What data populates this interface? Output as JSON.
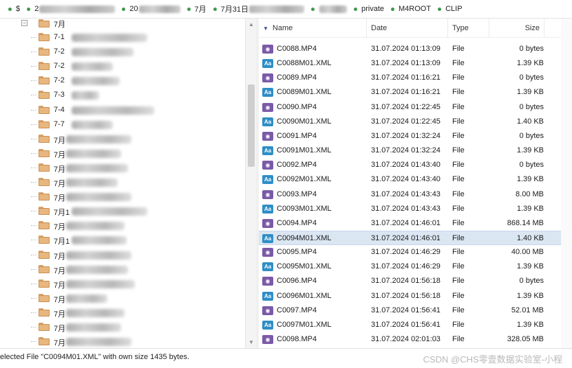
{
  "breadcrumb": {
    "items": [
      {
        "label": "$"
      },
      {
        "label": "2"
      },
      {
        "label": "20"
      },
      {
        "label": "7月"
      },
      {
        "label": "7月31日"
      },
      {
        "label": ""
      },
      {
        "label": "private"
      },
      {
        "label": "M4ROOT"
      },
      {
        "label": "CLIP"
      }
    ]
  },
  "tree": {
    "root_label": "7月",
    "root_toggle": "−",
    "folders": [
      {
        "label": "7-1"
      },
      {
        "label": "7-2"
      },
      {
        "label": "7-2"
      },
      {
        "label": "7-2"
      },
      {
        "label": "7-3"
      },
      {
        "label": "7-4"
      },
      {
        "label": "7-7"
      },
      {
        "label": "7月"
      },
      {
        "label": "7月"
      },
      {
        "label": "7月"
      },
      {
        "label": "7月"
      },
      {
        "label": "7月"
      },
      {
        "label": "7月1"
      },
      {
        "label": "7月"
      },
      {
        "label": "7月1"
      },
      {
        "label": "7月"
      },
      {
        "label": "7月"
      },
      {
        "label": "7月"
      },
      {
        "label": "7月"
      },
      {
        "label": "7月"
      },
      {
        "label": "7月"
      },
      {
        "label": "7月"
      },
      {
        "label": "7月"
      }
    ]
  },
  "files": {
    "columns": {
      "name": "Name",
      "date": "Date",
      "type": "Type",
      "size": "Size"
    },
    "rows": [
      {
        "name": "C0088.MP4",
        "date": "31.07.2024 01:13:09",
        "type": "File",
        "size": "0 bytes",
        "kind": "mp4"
      },
      {
        "name": "C0088M01.XML",
        "date": "31.07.2024 01:13:09",
        "type": "File",
        "size": "1.39 KB",
        "kind": "xml"
      },
      {
        "name": "C0089.MP4",
        "date": "31.07.2024 01:16:21",
        "type": "File",
        "size": "0 bytes",
        "kind": "mp4"
      },
      {
        "name": "C0089M01.XML",
        "date": "31.07.2024 01:16:21",
        "type": "File",
        "size": "1.39 KB",
        "kind": "xml"
      },
      {
        "name": "C0090.MP4",
        "date": "31.07.2024 01:22:45",
        "type": "File",
        "size": "0 bytes",
        "kind": "mp4"
      },
      {
        "name": "C0090M01.XML",
        "date": "31.07.2024 01:22:45",
        "type": "File",
        "size": "1.40 KB",
        "kind": "xml"
      },
      {
        "name": "C0091.MP4",
        "date": "31.07.2024 01:32:24",
        "type": "File",
        "size": "0 bytes",
        "kind": "mp4"
      },
      {
        "name": "C0091M01.XML",
        "date": "31.07.2024 01:32:24",
        "type": "File",
        "size": "1.39 KB",
        "kind": "xml"
      },
      {
        "name": "C0092.MP4",
        "date": "31.07.2024 01:43:40",
        "type": "File",
        "size": "0 bytes",
        "kind": "mp4"
      },
      {
        "name": "C0092M01.XML",
        "date": "31.07.2024 01:43:40",
        "type": "File",
        "size": "1.39 KB",
        "kind": "xml"
      },
      {
        "name": "C0093.MP4",
        "date": "31.07.2024 01:43:43",
        "type": "File",
        "size": "8.00 MB",
        "kind": "mp4"
      },
      {
        "name": "C0093M01.XML",
        "date": "31.07.2024 01:43:43",
        "type": "File",
        "size": "1.39 KB",
        "kind": "xml"
      },
      {
        "name": "C0094.MP4",
        "date": "31.07.2024 01:46:01",
        "type": "File",
        "size": "868.14 MB",
        "kind": "mp4"
      },
      {
        "name": "C0094M01.XML",
        "date": "31.07.2024 01:46:01",
        "type": "File",
        "size": "1.40 KB",
        "kind": "xml",
        "selected": true
      },
      {
        "name": "C0095.MP4",
        "date": "31.07.2024 01:46:29",
        "type": "File",
        "size": "40.00 MB",
        "kind": "mp4"
      },
      {
        "name": "C0095M01.XML",
        "date": "31.07.2024 01:46:29",
        "type": "File",
        "size": "1.39 KB",
        "kind": "xml"
      },
      {
        "name": "C0096.MP4",
        "date": "31.07.2024 01:56:18",
        "type": "File",
        "size": "0 bytes",
        "kind": "mp4"
      },
      {
        "name": "C0096M01.XML",
        "date": "31.07.2024 01:56:18",
        "type": "File",
        "size": "1.39 KB",
        "kind": "xml"
      },
      {
        "name": "C0097.MP4",
        "date": "31.07.2024 01:56:41",
        "type": "File",
        "size": "52.01 MB",
        "kind": "mp4"
      },
      {
        "name": "C0097M01.XML",
        "date": "31.07.2024 01:56:41",
        "type": "File",
        "size": "1.39 KB",
        "kind": "xml"
      },
      {
        "name": "C0098.MP4",
        "date": "31.07.2024 02:01:03",
        "type": "File",
        "size": "328.05 MB",
        "kind": "mp4"
      }
    ]
  },
  "icons": {
    "xml_glyph": "Aa",
    "mp4_glyph": "◉",
    "sort_glyph": "▼",
    "scroll_up": "▲",
    "scroll_down": "▼"
  },
  "status": {
    "text": "elected File \"C0094M01.XML\" with own size 1435 bytes.",
    "watermark": "CSDN @CHS零壹数据实验室-小程"
  },
  "colors": {
    "selection": "#dbe6f3",
    "mp4_icon": "#7a5aa8",
    "xml_icon": "#2f8ec6",
    "folder": "#e8b77f",
    "breadcrumb_dot": "#3d9a4b"
  }
}
